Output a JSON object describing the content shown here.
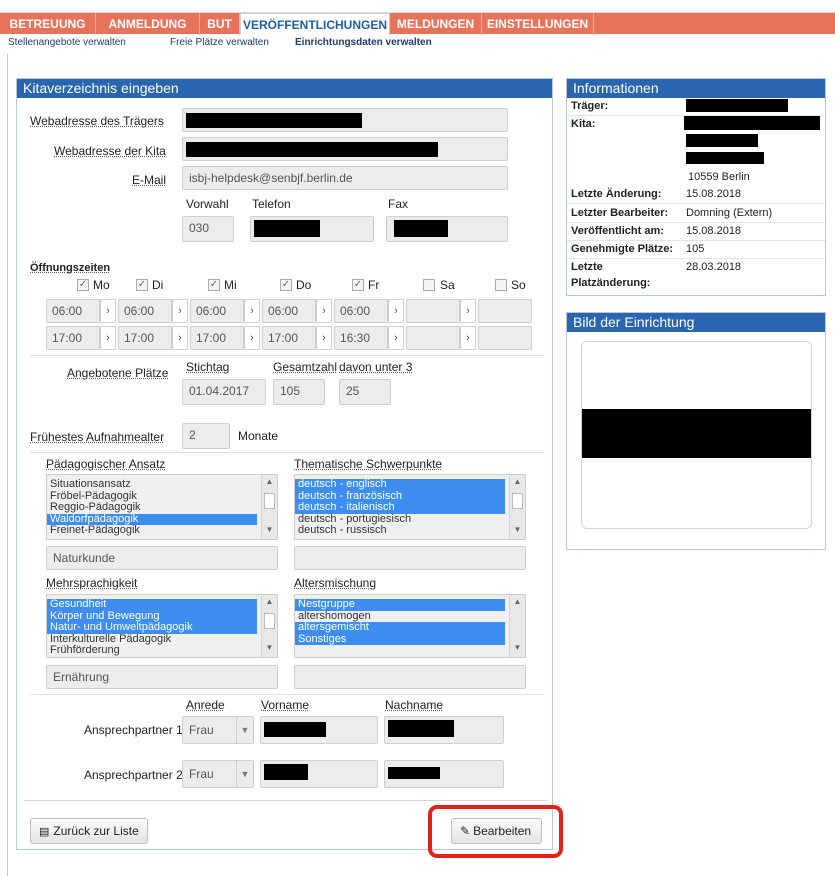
{
  "nav": {
    "tabs": [
      {
        "label": "BETREUUNG"
      },
      {
        "label": "ANMELDUNG"
      },
      {
        "label": "BUT"
      },
      {
        "label": "VERÖFFENTLICHUNGEN"
      },
      {
        "label": "MELDUNGEN"
      },
      {
        "label": "EINSTELLUNGEN"
      }
    ],
    "subtabs": [
      {
        "label": "Stellenangebote verwalten"
      },
      {
        "label": "Freie Plätze verwalten"
      },
      {
        "label": "Einrichtungsdaten verwalten"
      }
    ]
  },
  "form": {
    "title": "Kitaverzeichnis eingeben",
    "traeger_url_label": "Webadresse des Trägers",
    "kita_url_label": "Webadresse der Kita",
    "email_label": "E-Mail",
    "email_value": "isbj-helpdesk@senbjf.berlin.de",
    "vorwahl_label": "Vorwahl",
    "telefon_label": "Telefon",
    "fax_label": "Fax",
    "vorwahl_value": "030",
    "oeffnungszeiten_label": "Öffnungszeiten",
    "days": [
      {
        "label": "Mo",
        "checked": true,
        "open": "06:00",
        "close": "17:00"
      },
      {
        "label": "Di",
        "checked": true,
        "open": "06:00",
        "close": "17:00"
      },
      {
        "label": "Mi",
        "checked": true,
        "open": "06:00",
        "close": "17:00"
      },
      {
        "label": "Do",
        "checked": true,
        "open": "06:00",
        "close": "17:00"
      },
      {
        "label": "Fr",
        "checked": true,
        "open": "06:00",
        "close": "16:30"
      },
      {
        "label": "Sa",
        "checked": false,
        "open": "",
        "close": ""
      },
      {
        "label": "So",
        "checked": false,
        "open": "",
        "close": ""
      }
    ],
    "arrow_glyph": "›",
    "check_glyph": "✓",
    "plaetze_label": "Angebotene Plätze",
    "stichtag_label": "Stichtag",
    "gesamtzahl_label": "Gesamtzahl",
    "unter3_label": "davon unter 3",
    "stichtag_value": "01.04.2017",
    "gesamtzahl_value": "105",
    "unter3_value": "25",
    "aufnahmealter_label": "Frühestes Aufnahmealter",
    "aufnahmealter_value": "2",
    "aufnahmealter_unit": "Monate",
    "paed_label": "Pädagogischer Ansatz",
    "paed_items": [
      {
        "label": "Situationsansatz",
        "selected": false
      },
      {
        "label": "Fröbel-Pädagogik",
        "selected": false
      },
      {
        "label": "Reggio-Pädagogik",
        "selected": false
      },
      {
        "label": "Waldorfpädagogik",
        "selected": true
      },
      {
        "label": "Freinet-Pädagogik",
        "selected": false
      }
    ],
    "paed_extra": "Naturkunde",
    "thema_label": "Thematische Schwerpunkte",
    "thema_items": [
      {
        "label": "deutsch - englisch",
        "selected": true
      },
      {
        "label": "deutsch - französisch",
        "selected": true
      },
      {
        "label": "deutsch - italienisch",
        "selected": true
      },
      {
        "label": "deutsch - portugiesisch",
        "selected": false
      },
      {
        "label": "deutsch - russisch",
        "selected": false
      }
    ],
    "thema_extra": "",
    "mehr_label": "Mehrsprachigkeit",
    "mehr_items": [
      {
        "label": "Gesundheit",
        "selected": true
      },
      {
        "label": "Körper und Bewegung",
        "selected": true
      },
      {
        "label": "Natur- und Umweltpädagogik",
        "selected": true
      },
      {
        "label": "Interkulturelle Pädagogik",
        "selected": false
      },
      {
        "label": "Frühförderung",
        "selected": false
      }
    ],
    "mehr_extra": "Ernährung",
    "alters_label": "Altersmischung",
    "alters_items": [
      {
        "label": "Nestgruppe",
        "selected": true
      },
      {
        "label": "altershomogen",
        "selected": false
      },
      {
        "label": "altersgemischt",
        "selected": true
      },
      {
        "label": "Sonstiges",
        "selected": true
      }
    ],
    "alters_extra": "",
    "anrede_label": "Anrede",
    "vorname_label": "Vorname",
    "nachname_label": "Nachname",
    "ansprech1_label": "Ansprechpartner 1",
    "ansprech2_label": "Ansprechpartner 2",
    "ansprech1_anrede": "Frau",
    "ansprech2_anrede": "Frau",
    "back_button": "Zurück zur Liste",
    "edit_button": "Bearbeiten",
    "highlight_color": "#e2231a"
  },
  "info": {
    "title": "Informationen",
    "traeger_label": "Träger:",
    "kita_label": "Kita:",
    "kita_city": "10559 Berlin",
    "letzte_aenderung_label": "Letzte Änderung:",
    "letzte_aenderung_value": "15.08.2018",
    "bearbeiter_label": "Letzter Bearbeiter:",
    "bearbeiter_value": "Domning (Extern)",
    "veroeffentlicht_label": "Veröffentlicht am:",
    "veroeffentlicht_value": "15.08.2018",
    "plaetze_label": "Genehmigte Plätze:",
    "plaetze_value": "105",
    "platzaenderung_label_1": "Letzte",
    "platzaenderung_label_2": "Platzänderung:",
    "platzaenderung_value": "28.03.2018"
  },
  "bild": {
    "title": "Bild der Einrichtung"
  },
  "colors": {
    "nav": "#e8735b",
    "panel_head": "#2a66b0",
    "selection": "#3d8ef0"
  }
}
